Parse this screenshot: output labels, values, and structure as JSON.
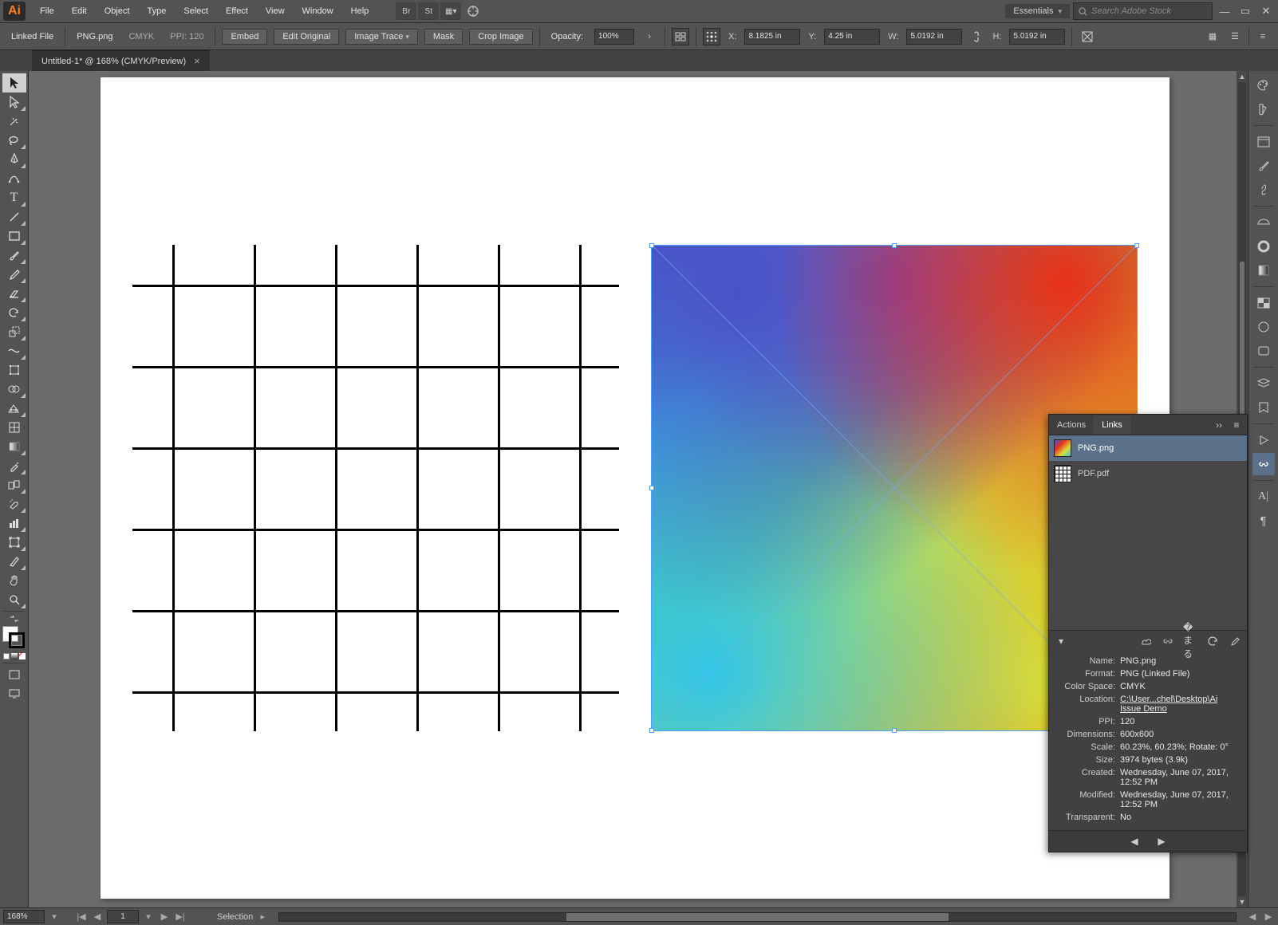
{
  "menu": {
    "items": [
      "File",
      "Edit",
      "Object",
      "Type",
      "Select",
      "Effect",
      "View",
      "Window",
      "Help"
    ],
    "workspace": "Essentials",
    "stock_placeholder": "Search Adobe Stock"
  },
  "controlbar": {
    "linked_file": "Linked File",
    "filename": "PNG.png",
    "colormode": "CMYK",
    "ppi_label": "PPI:",
    "ppi": "120",
    "embed": "Embed",
    "edit_original": "Edit Original",
    "image_trace": "Image Trace",
    "mask": "Mask",
    "crop": "Crop Image",
    "opacity_label": "Opacity:",
    "opacity": "100%",
    "x_label": "X:",
    "x": "8.1825 in",
    "y_label": "Y:",
    "y": "4.25 in",
    "w_label": "W:",
    "w": "5.0192 in",
    "h_label": "H:",
    "h": "5.0192 in"
  },
  "tab": {
    "title": "Untitled-1* @ 168% (CMYK/Preview)"
  },
  "statusbar": {
    "zoom": "168%",
    "artboard": "1",
    "mode": "Selection"
  },
  "links_panel": {
    "tab_actions": "Actions",
    "tab_links": "Links",
    "items": [
      {
        "name": "PNG.png",
        "thumb": "gradient"
      },
      {
        "name": "PDF.pdf",
        "thumb": "grid"
      }
    ],
    "details": {
      "Name": "PNG.png",
      "Format": "PNG (Linked File)",
      "Color Space": "CMYK",
      "Location": "C:\\User...chel\\Desktop\\Ai Issue Demo",
      "PPI": "120",
      "Dimensions": "600x600",
      "Scale": "60.23%, 60.23%; Rotate: 0°",
      "Size": "3974 bytes (3.9k)",
      "Created": "Wednesday, June 07, 2017, 12:52 PM",
      "Modified": "Wednesday, June 07, 2017, 12:52 PM",
      "Transparent": "No"
    }
  }
}
